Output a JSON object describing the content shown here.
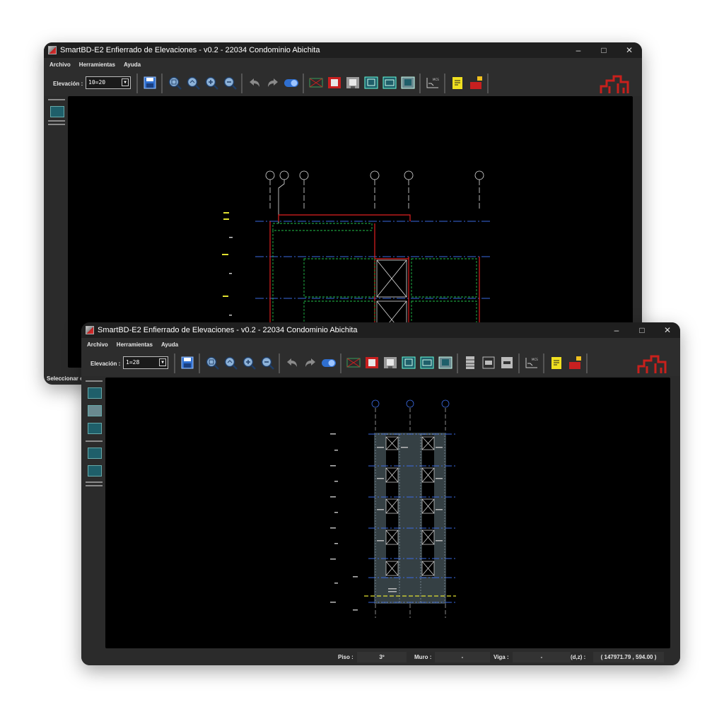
{
  "colors": {
    "accent_red": "#c8201c",
    "toolbar_bg": "#2d2d2d",
    "canvas_bg": "#000000",
    "cad_red": "#e02020",
    "cad_green": "#22c04a",
    "cad_blue": "#3a6ae0",
    "cad_white": "#e0e0e0",
    "cad_yellow": "#e0e030",
    "structure_fill": "#354044"
  },
  "window_back": {
    "title": "SmartBD-E2 Enfierrado de Elevaciones - v0.2 - 22034 Condominio Abichita",
    "menu": [
      "Archivo",
      "Herramientas",
      "Ayuda"
    ],
    "elevation_label": "Elevación :",
    "elevation_value": "10=20",
    "status_text": "Seleccionar e"
  },
  "window_front": {
    "title": "SmartBD-E2 Enfierrado de Elevaciones - v0.2 - 22034 Condominio Abichita",
    "menu": [
      "Archivo",
      "Herramientas",
      "Ayuda"
    ],
    "elevation_label": "Elevación :",
    "elevation_value": "1=28",
    "status": {
      "piso_label": "Piso :",
      "piso_value": "3º",
      "muro_label": "Muro :",
      "muro_value": "-",
      "viga_label": "Viga :",
      "viga_value": "-",
      "coord_label": "(d,z) :",
      "coord_value": "( 147971.79 , 594.00 )"
    }
  },
  "toolbar_icons_back": [
    "dropdown-icon",
    "save-icon",
    "zoom-extents-icon",
    "zoom-window-icon",
    "zoom-in-icon",
    "zoom-out-icon",
    "undo-icon",
    "redo-icon",
    "toggle-icon",
    "wall-x-icon",
    "wall-red-icon",
    "wall-gray-icon",
    "panel-cyan-icon",
    "panel-cyan2-icon",
    "panel-cyan3-icon",
    "rebar-table-icon",
    "notes-icon",
    "report-icon"
  ],
  "toolbar_icons_front": [
    "dropdown-icon",
    "save-icon",
    "zoom-extents-icon",
    "zoom-window-icon",
    "zoom-in-icon",
    "zoom-out-icon",
    "undo-icon",
    "redo-icon",
    "toggle-icon",
    "wall-x-icon",
    "wall-red-icon",
    "wall-gray-icon",
    "panel-cyan-icon",
    "panel-cyan2-icon",
    "panel-cyan3-icon",
    "column-icon",
    "beam-icon",
    "beam2-icon",
    "rebar-table-icon",
    "notes-icon",
    "report-icon"
  ]
}
